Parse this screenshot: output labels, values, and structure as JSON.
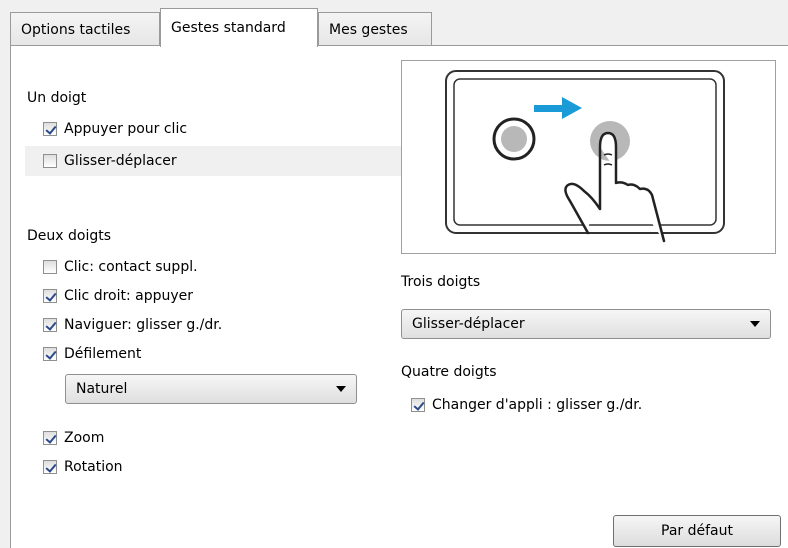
{
  "tabs": [
    {
      "label": "Options tactiles",
      "active": false
    },
    {
      "label": "Gestes standard",
      "active": true
    },
    {
      "label": "Mes gestes",
      "active": false
    }
  ],
  "one_finger": {
    "title": "Un doigt",
    "items": [
      {
        "label": "Appuyer pour clic",
        "checked": true
      },
      {
        "label": "Glisser-déplacer",
        "checked": false
      }
    ]
  },
  "two_fingers": {
    "title": "Deux doigts",
    "items": [
      {
        "label": "Clic: contact suppl.",
        "checked": false
      },
      {
        "label": "Clic droit: appuyer",
        "checked": true
      },
      {
        "label": "Naviguer: glisser g./dr.",
        "checked": true
      },
      {
        "label": "Défilement",
        "checked": true
      },
      {
        "label": "Zoom",
        "checked": true
      },
      {
        "label": "Rotation",
        "checked": true
      }
    ],
    "scroll_select": "Naturel"
  },
  "three_fingers": {
    "title": "Trois doigts",
    "select": "Glisser-déplacer"
  },
  "four_fingers": {
    "title": "Quatre doigts",
    "items": [
      {
        "label": "Changer d'appli : glisser g./dr.",
        "checked": true
      }
    ]
  },
  "buttons": {
    "default": "Par défaut"
  },
  "colors": {
    "arrow": "#1a9ad6",
    "touch": "#b8b8b8"
  },
  "icons": {
    "gesture_preview": "finger-tap-drag-illustration"
  }
}
